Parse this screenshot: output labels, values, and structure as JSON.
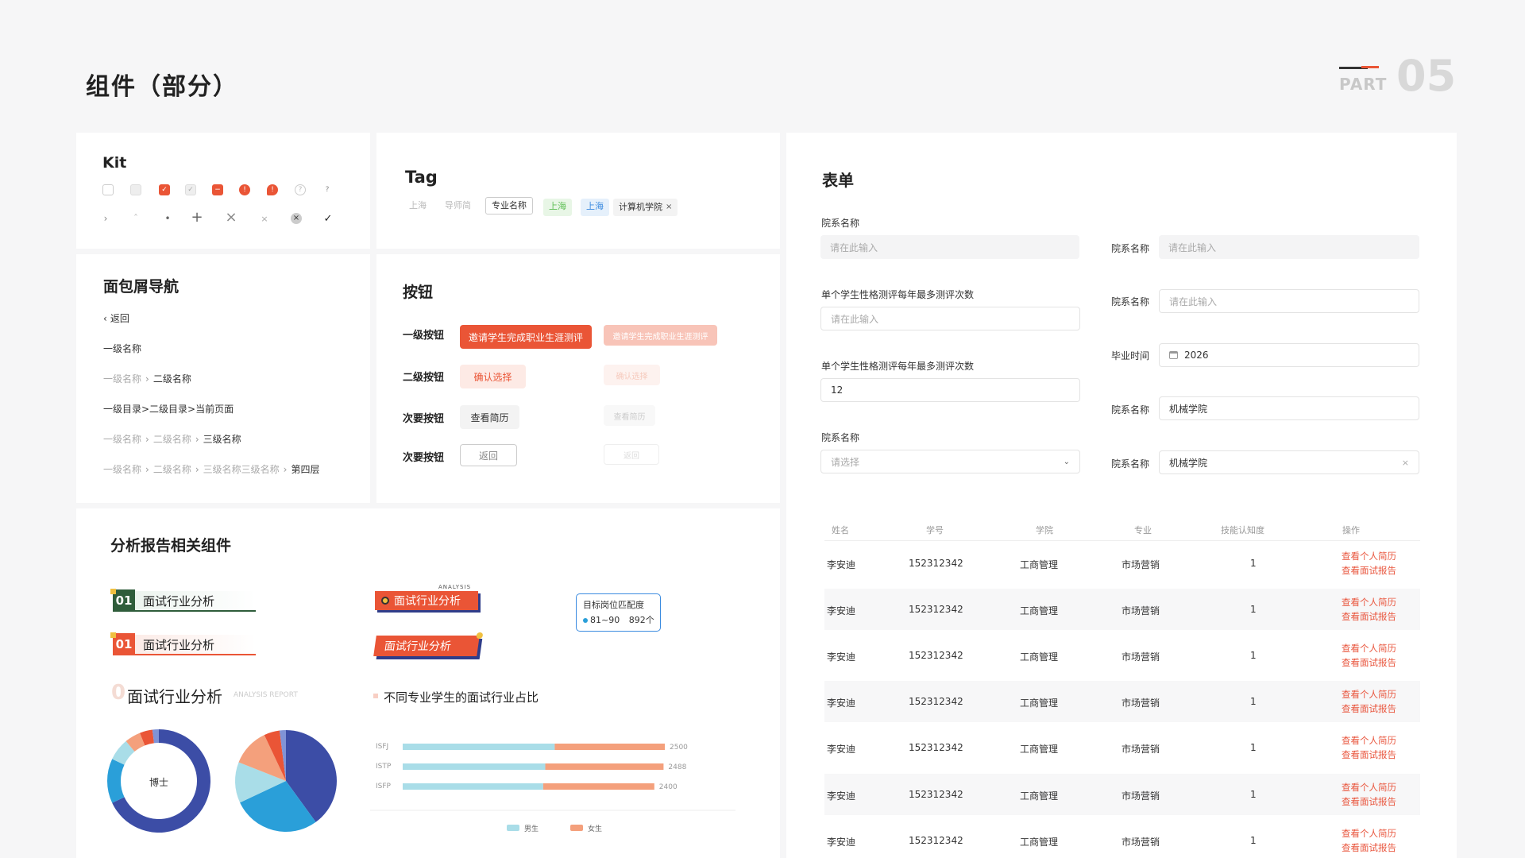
{
  "page": {
    "title": "组件（部分）",
    "part_label": "PART",
    "part_number": "05"
  },
  "kit": {
    "title": "Kit"
  },
  "tags": {
    "title": "Tag",
    "items": [
      "上海",
      "导师简",
      "专业名称",
      "上海",
      "上海",
      "计算机学院"
    ],
    "close_glyph": "×"
  },
  "breadcrumb": {
    "title": "面包屑导航",
    "back": "返回",
    "l1": "一级名称",
    "r3a": "一级名称",
    "r3b": "二级名称",
    "r4": "一级目录>二级目录>当前页面",
    "r5a": "一级名称",
    "r5b": "二级名称",
    "r5c": "三级名称",
    "r6a": "一级名称",
    "r6b": "二级名称",
    "r6c": "三级名称三级名称",
    "r6d": "第四层"
  },
  "buttons": {
    "title": "按钮",
    "primary_label": "一级按钮",
    "primary_text": "邀请学生完成职业生涯测评",
    "secondary_label": "二级按钮",
    "secondary_text": "确认选择",
    "tertiary_label": "次要按钮",
    "tertiary_text": "查看简历",
    "outline_label": "次要按钮",
    "outline_text": "返回"
  },
  "form": {
    "title": "表单",
    "f1_label": "院系名称",
    "f1_placeholder": "请在此输入",
    "f2_label": "单个学生性格测评每年最多测评次数",
    "f2_placeholder": "请在此输入",
    "f3_label": "单个学生性格测评每年最多测评次数",
    "f3_value": "12",
    "f4_label": "院系名称",
    "f4_placeholder": "请选择",
    "r1_label": "院系名称",
    "r1_placeholder": "请在此输入",
    "r2_label": "院系名称",
    "r2_placeholder": "请在此输入",
    "r3_label": "毕业时间",
    "r3_value": "2026",
    "r4_label": "院系名称",
    "r4_value": "机械学院",
    "r5_label": "院系名称",
    "r5_value": "机械学院",
    "r5_clear": "×"
  },
  "table": {
    "headers": [
      "姓名",
      "学号",
      "学院",
      "专业",
      "技能认知度",
      "操作"
    ],
    "rows": [
      {
        "name": "李安迪",
        "id": "152312342",
        "college": "工商管理",
        "major": "市场营销",
        "score": "1"
      },
      {
        "name": "李安迪",
        "id": "152312342",
        "college": "工商管理",
        "major": "市场营销",
        "score": "1"
      },
      {
        "name": "李安迪",
        "id": "152312342",
        "college": "工商管理",
        "major": "市场营销",
        "score": "1"
      },
      {
        "name": "李安迪",
        "id": "152312342",
        "college": "工商管理",
        "major": "市场营销",
        "score": "1"
      },
      {
        "name": "李安迪",
        "id": "152312342",
        "college": "工商管理",
        "major": "市场营销",
        "score": "1"
      },
      {
        "name": "李安迪",
        "id": "152312342",
        "college": "工商管理",
        "major": "市场营销",
        "score": "1"
      },
      {
        "name": "李安迪",
        "id": "152312342",
        "college": "工商管理",
        "major": "市场营销",
        "score": "1"
      }
    ],
    "action1": "查看个人简历",
    "action2": "查看面试报告"
  },
  "analysis": {
    "title": "分析报告相关组件",
    "h1_num": "01",
    "h1_text": "面试行业分析",
    "h2_num": "01",
    "h2_text": "面试行业分析",
    "h3_text": "面试行业分析",
    "h3_sub": "ANALYSIS REPORT",
    "ribbon1_small": "ANALYSIS",
    "ribbon1_text": "面试行业分析",
    "ribbon2_text": "面试行业分析",
    "match_title": "目标岗位匹配度",
    "match_range": "81~90",
    "match_count": "892个",
    "donut_center": "博士",
    "colors": {
      "accent": "#ea5536",
      "green": "#2f5d3b",
      "navy": "#3c4da6",
      "blue": "#2a9fd9",
      "lightblue": "#a9dde8",
      "salmon": "#f4a07c"
    }
  },
  "chart_data": {
    "type": "bar",
    "orientation": "horizontal",
    "stacked": true,
    "title": "不同专业学生的面试行业占比",
    "categories": [
      "ISFJ",
      "ISTP",
      "ISFP"
    ],
    "series": [
      {
        "name": "男生",
        "values": [
          1450,
          1360,
          1340
        ],
        "color": "#a9dde8"
      },
      {
        "name": "女生",
        "values": [
          1050,
          1128,
          1060
        ],
        "color": "#f4a07c"
      }
    ],
    "totals": [
      "2500",
      "2488",
      "2400"
    ],
    "xlim": [
      0,
      2500
    ],
    "legend": "bottom"
  },
  "pie_data": [
    {
      "type": "donut",
      "values": [
        68,
        14,
        7,
        5,
        4,
        2
      ],
      "colors": [
        "#3c4da6",
        "#2a9fd9",
        "#a9dde8",
        "#f4a07c",
        "#ea5536",
        "#8093d6"
      ]
    },
    {
      "type": "pie",
      "values": [
        40,
        28,
        13,
        12,
        5,
        2
      ],
      "colors": [
        "#3c4da6",
        "#2a9fd9",
        "#a9dde8",
        "#f4a07c",
        "#ea5536",
        "#8093d6"
      ]
    }
  ]
}
